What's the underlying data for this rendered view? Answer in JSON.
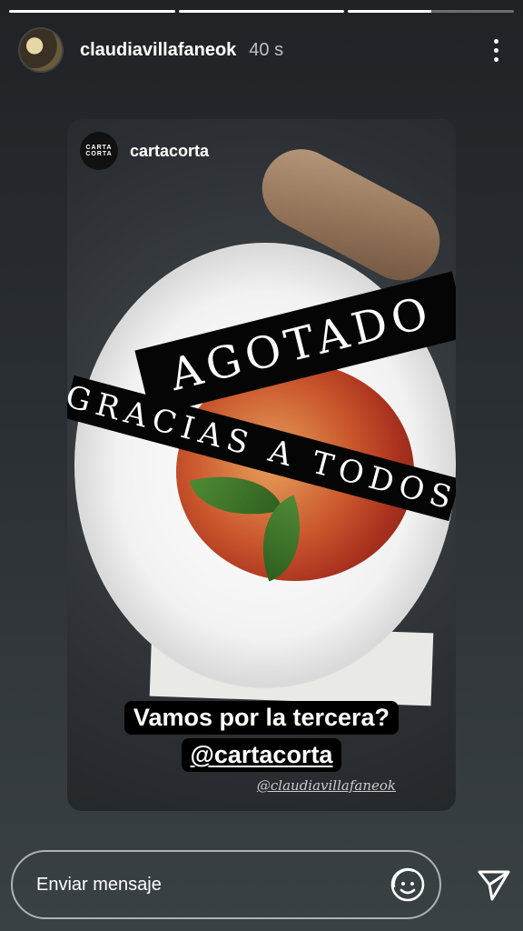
{
  "story": {
    "segments": [
      1,
      1,
      0.5
    ],
    "username": "claudiavillafaneok",
    "time": "40 s"
  },
  "post": {
    "username": "cartacorta",
    "logo_text": "CARTA CORTA",
    "banner_top": "AGOTADO",
    "banner_bottom": "GRACIAS A TODOS",
    "caption_line1": "Vamos por la tercera?",
    "caption_line2": "@cartacorta",
    "watermark": "@claudiavillafaneok"
  },
  "footer": {
    "input_placeholder": "Enviar mensaje"
  },
  "icons": {
    "more": "more-vertical-icon",
    "sticker": "sticker-icon",
    "send": "send-icon"
  }
}
